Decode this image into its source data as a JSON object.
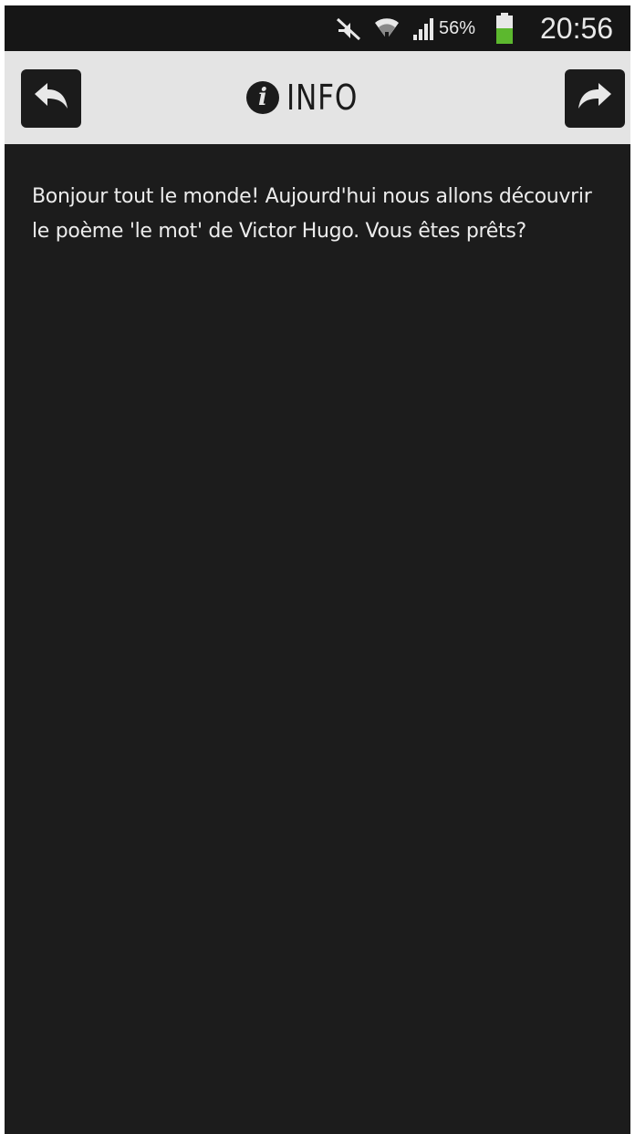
{
  "status_bar": {
    "battery_percent": "56%",
    "time": "20:56",
    "icons": [
      "mute-icon",
      "wifi-icon",
      "signal-icon",
      "battery-icon"
    ],
    "battery_level": 0.56,
    "battery_color": "#5cb82e"
  },
  "header": {
    "title": "INFO",
    "back_icon": "reply-arrow-icon",
    "forward_icon": "forward-arrow-icon",
    "info_icon_glyph": "i"
  },
  "content": {
    "text": "Bonjour tout le monde! Aujourd'hui nous allons découvrir le poème 'le mot' de Victor Hugo. Vous êtes prêts?"
  },
  "colors": {
    "background": "#1c1c1c",
    "header_bg": "#e4e4e4",
    "text": "#ececec"
  }
}
